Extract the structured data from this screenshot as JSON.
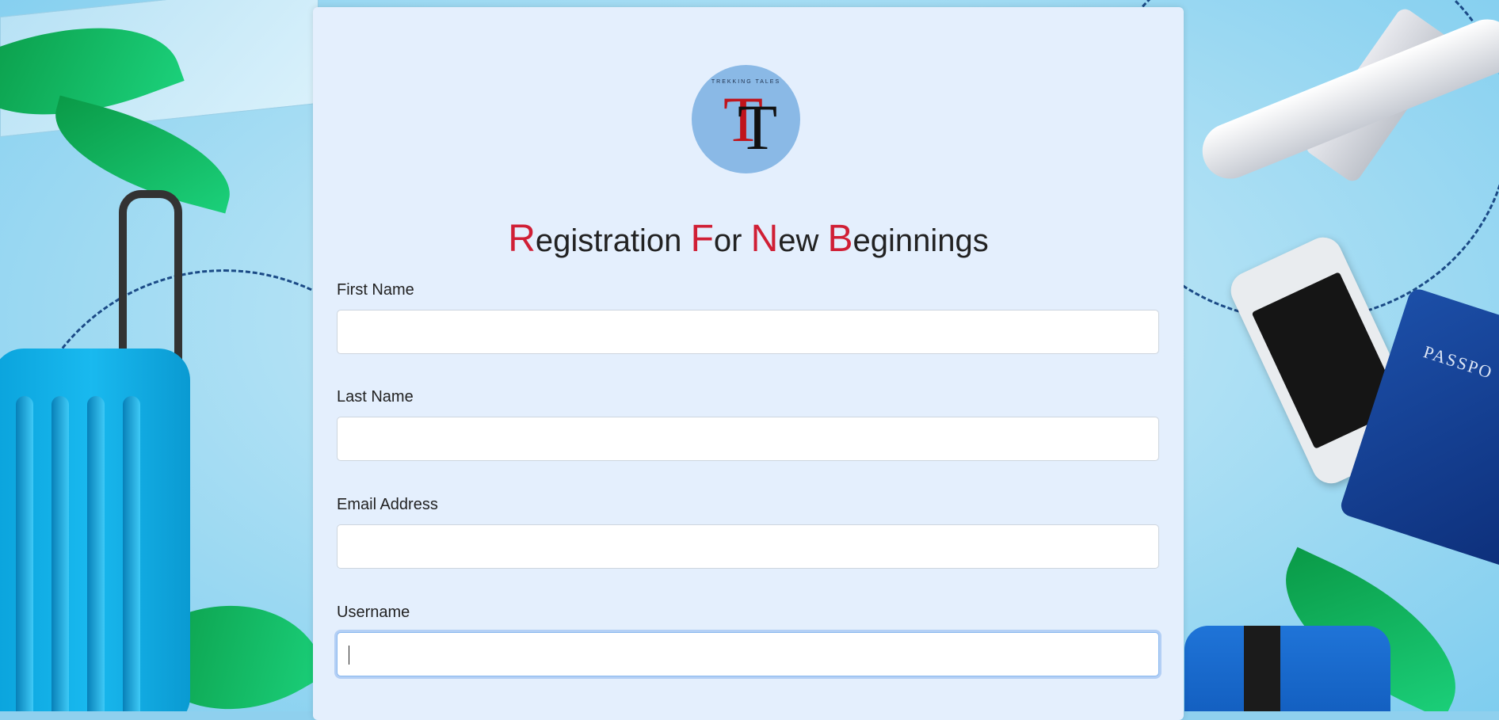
{
  "logo": {
    "tagline": "TREKKING TALES",
    "letters": [
      "T",
      "T"
    ]
  },
  "title": {
    "words": [
      {
        "cap": "R",
        "rest": "egistration"
      },
      {
        "cap": "F",
        "rest": "or"
      },
      {
        "cap": "N",
        "rest": "ew"
      },
      {
        "cap": "B",
        "rest": "eginnings"
      }
    ]
  },
  "form": {
    "first_name_label": "First Name",
    "first_name_value": "",
    "last_name_label": "Last Name",
    "last_name_value": "",
    "email_label": "Email Address",
    "email_value": "",
    "username_label": "Username",
    "username_value": ""
  },
  "background": {
    "passport_text": "PASSPO"
  },
  "colors": {
    "accent_red": "#d01f35",
    "card_bg": "#e4effd",
    "logo_circle": "#8ab9e6"
  }
}
